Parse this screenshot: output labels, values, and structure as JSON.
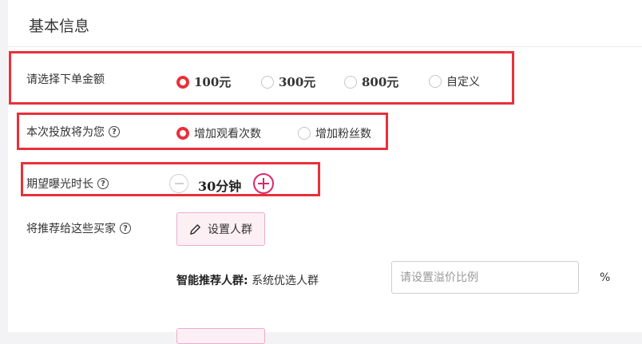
{
  "section": {
    "title": "基本信息"
  },
  "amount": {
    "label": "请选择下单金额",
    "options": [
      {
        "label": "100元",
        "selected": true
      },
      {
        "label": "300元",
        "selected": false
      },
      {
        "label": "800元",
        "selected": false
      },
      {
        "label": "自定义",
        "selected": false
      }
    ]
  },
  "goal": {
    "label": "本次投放将为您",
    "help_icon": "question-circle-icon",
    "options": [
      {
        "label": "增加观看次数",
        "selected": true
      },
      {
        "label": "增加粉丝数",
        "selected": false
      }
    ]
  },
  "duration": {
    "label": "期望曝光时长",
    "help_icon": "question-circle-icon",
    "value": "30分钟"
  },
  "audience": {
    "label": "将推荐给这些买家",
    "help_icon": "question-circle-icon",
    "set_button": "设置人群",
    "smart_label": "智能推荐人群:",
    "smart_value": "系统优选人群",
    "premium_placeholder": "请设置溢价比例",
    "unit": "%"
  },
  "colors": {
    "accent": "#e8313a",
    "brand_pink": "#d9286e",
    "highlight_box": "#e8313a"
  }
}
